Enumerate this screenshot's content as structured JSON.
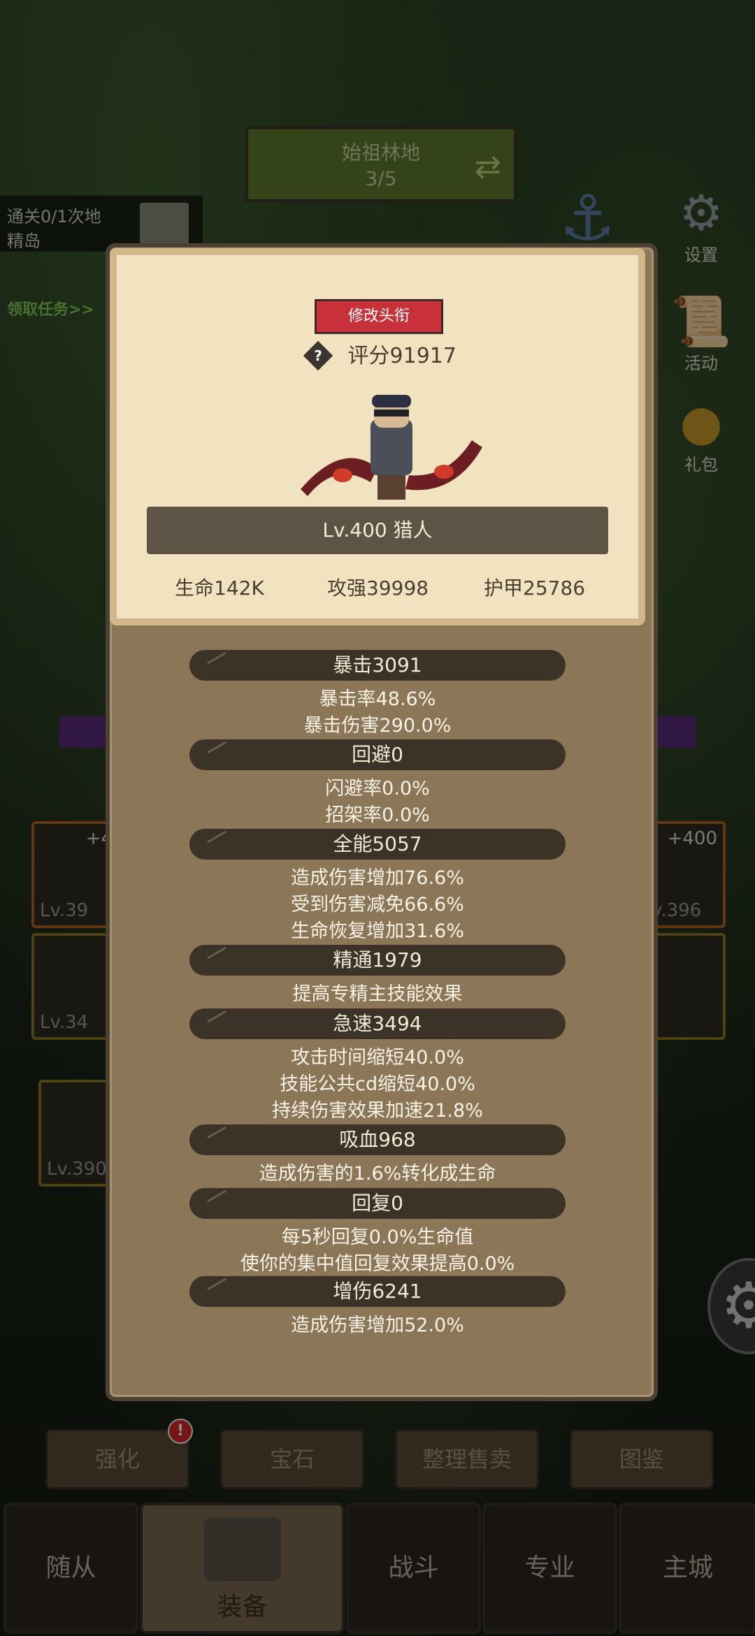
{
  "zone": {
    "name": "始祖林地",
    "progress": "3/5"
  },
  "quest": {
    "text_line1": "通关0/1次地",
    "text_line2": "精岛",
    "claim": "领取任务>>"
  },
  "side_menu": {
    "settings": "设置",
    "events": "活动",
    "gift": "礼包"
  },
  "equipment_slots": [
    {
      "level": "Lv.39",
      "plus": "+4"
    },
    {
      "level": "Lv.34",
      "plus": ""
    },
    {
      "level": "Lv.390",
      "plus": ""
    },
    {
      "level": "v.396",
      "plus": "+400"
    }
  ],
  "action_buttons": [
    "强化",
    "宝石",
    "整理售卖",
    "图鉴"
  ],
  "bottom_tabs": [
    "随从",
    "装备",
    "战斗",
    "专业",
    "主城"
  ],
  "profile": {
    "title_button": "修改头衔",
    "score": "评分91917",
    "level_class": "Lv.400 猎人",
    "hp": "生命142K",
    "attack": "攻强39998",
    "armor": "护甲25786"
  },
  "stats": [
    {
      "head": "暴击3091",
      "lines": [
        "暴击率48.6%",
        "暴击伤害290.0%"
      ]
    },
    {
      "head": "回避0",
      "lines": [
        "闪避率0.0%",
        "招架率0.0%"
      ]
    },
    {
      "head": "全能5057",
      "lines": [
        "造成伤害增加76.6%",
        "受到伤害减免66.6%",
        "生命恢复增加31.6%"
      ]
    },
    {
      "head": "精通1979",
      "lines": [
        "提高专精主技能效果"
      ]
    },
    {
      "head": "急速3494",
      "lines": [
        "攻击时间缩短40.0%",
        "技能公共cd缩短40.0%",
        "持续伤害效果加速21.8%"
      ]
    },
    {
      "head": "吸血968",
      "lines": [
        "造成伤害的1.6%转化成生命"
      ]
    },
    {
      "head": "回复0",
      "lines": [
        "每5秒回复0.0%生命值",
        "使你的集中值回复效果提高0.0%"
      ]
    },
    {
      "head": "增伤6241",
      "lines": [
        "造成伤害增加52.0%"
      ]
    }
  ],
  "colors": {
    "panel": "#8b7658",
    "card": "#f1e3c0",
    "title_button": "#c8303a",
    "stat_head": "#3b3328"
  }
}
